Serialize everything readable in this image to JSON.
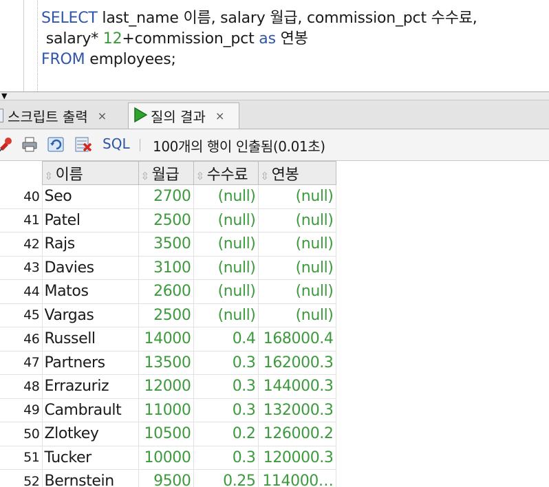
{
  "editor": {
    "line1": {
      "kw1": "SELECT",
      "rest": " last_name 이름, salary 월급, commission_pct 수수료,"
    },
    "line2": {
      "part1": " salary* ",
      "num": "12",
      "part2": "+commission_pct ",
      "kw": "as",
      "part3": " 연봉"
    },
    "line3": {
      "kw": "FROM",
      "rest": " employees;"
    }
  },
  "tabs": {
    "script": {
      "label": "스크립트 출력",
      "close": "×"
    },
    "result": {
      "label": "질의 결과",
      "close": "×"
    }
  },
  "toolbar": {
    "sql_label": "SQL",
    "separator": "|",
    "status": "100개의 행이 인출됨(0.01초)"
  },
  "grid": {
    "columns": [
      "이름",
      "월급",
      "수수료",
      "연봉"
    ],
    "rows": [
      [
        "40",
        "Seo",
        "2700",
        "(null)",
        "(null)"
      ],
      [
        "41",
        "Patel",
        "2500",
        "(null)",
        "(null)"
      ],
      [
        "42",
        "Rajs",
        "3500",
        "(null)",
        "(null)"
      ],
      [
        "43",
        "Davies",
        "3100",
        "(null)",
        "(null)"
      ],
      [
        "44",
        "Matos",
        "2600",
        "(null)",
        "(null)"
      ],
      [
        "45",
        "Vargas",
        "2500",
        "(null)",
        "(null)"
      ],
      [
        "46",
        "Russell",
        "14000",
        "0.4",
        "168000.4"
      ],
      [
        "47",
        "Partners",
        "13500",
        "0.3",
        "162000.3"
      ],
      [
        "48",
        "Errazuriz",
        "12000",
        "0.3",
        "144000.3"
      ],
      [
        "49",
        "Cambrault",
        "11000",
        "0.3",
        "132000.3"
      ],
      [
        "50",
        "Zlotkey",
        "10500",
        "0.2",
        "126000.2"
      ],
      [
        "51",
        "Tucker",
        "10000",
        "0.3",
        "120000.3"
      ],
      [
        "52",
        "Bernstein",
        "9500",
        "0.25",
        "114000…"
      ]
    ]
  },
  "colors": {
    "keyword": "#2f56a8",
    "number": "#3c9a3c",
    "run": "#2fa52f"
  },
  "icons": [
    "pin-icon",
    "print-icon",
    "refresh-icon",
    "delete-icon",
    "run-icon",
    "script-icon",
    "sort-icon",
    "collapse-icon"
  ]
}
